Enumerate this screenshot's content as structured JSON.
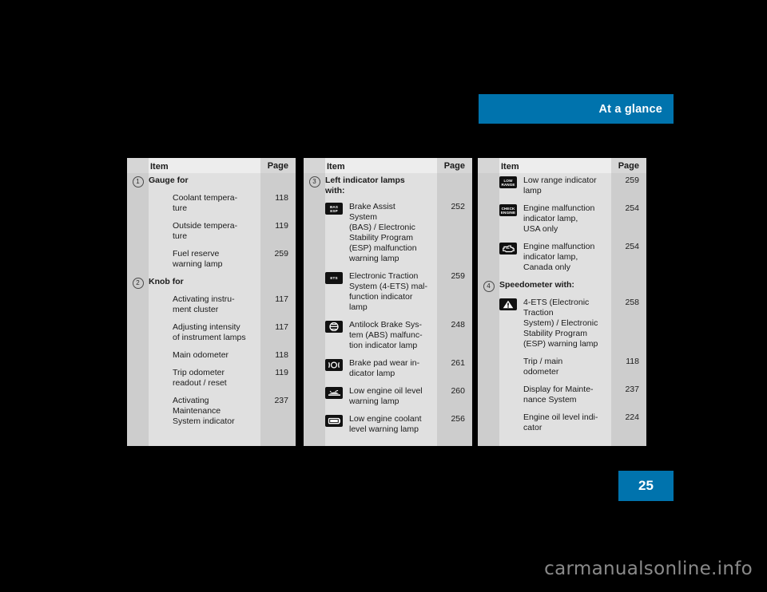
{
  "header": {
    "title": "At a glance",
    "accent_color": "#0073ad"
  },
  "page_badge": {
    "number": "25",
    "color": "#0073ad"
  },
  "watermark": "carmanualsonline.info",
  "table_headers": {
    "item": "Item",
    "page": "Page"
  },
  "tables": [
    {
      "id": "table-1",
      "rows": [
        {
          "marker": "1",
          "icon": null,
          "item": "Gauge for",
          "page": "",
          "bold": true
        },
        {
          "marker": "",
          "icon": null,
          "item": "Coolant tempera-\nture",
          "page": "118",
          "bold": false
        },
        {
          "marker": "",
          "icon": null,
          "item": "Outside tempera-\nture",
          "page": "119",
          "bold": false
        },
        {
          "marker": "",
          "icon": null,
          "item": "Fuel reserve\nwarning lamp",
          "page": "259",
          "bold": false
        },
        {
          "marker": "2",
          "icon": null,
          "item": "Knob for",
          "page": "",
          "bold": true
        },
        {
          "marker": "",
          "icon": null,
          "item": "Activating instru-\nment cluster",
          "page": "117",
          "bold": false
        },
        {
          "marker": "",
          "icon": null,
          "item": "Adjusting intensity\nof instrument lamps",
          "page": "117",
          "bold": false
        },
        {
          "marker": "",
          "icon": null,
          "item": "Main odometer",
          "page": "118",
          "bold": false
        },
        {
          "marker": "",
          "icon": null,
          "item": "Trip odometer\nreadout / reset",
          "page": "119",
          "bold": false
        },
        {
          "marker": "",
          "icon": null,
          "item": "Activating\nMaintenance\nSystem indicator",
          "page": "237",
          "bold": false
        }
      ]
    },
    {
      "id": "table-2",
      "rows": [
        {
          "marker": "3",
          "icon": null,
          "item": "Left indicator lamps\nwith:",
          "page": "",
          "bold": true
        },
        {
          "marker": "",
          "icon": "bas-esp-icon",
          "item": "Brake Assist\nSystem\n(BAS) / Electronic\nStability Program\n(ESP) malfunction\nwarning lamp",
          "page": "252",
          "bold": false
        },
        {
          "marker": "",
          "icon": "ets-icon",
          "item": "Electronic Traction\nSystem (4-ETS) mal-\nfunction indicator\nlamp",
          "page": "259",
          "bold": false
        },
        {
          "marker": "",
          "icon": "abs-icon",
          "item": "Antilock Brake Sys-\ntem (ABS) malfunc-\ntion indicator lamp",
          "page": "248",
          "bold": false
        },
        {
          "marker": "",
          "icon": "brake-pad-wear-icon",
          "item": "Brake pad wear in-\ndicator lamp",
          "page": "261",
          "bold": false
        },
        {
          "marker": "",
          "icon": "low-engine-oil-icon",
          "item": "Low engine oil level\nwarning lamp",
          "page": "260",
          "bold": false
        },
        {
          "marker": "",
          "icon": "low-coolant-icon",
          "item": "Low engine coolant\nlevel warning lamp",
          "page": "256",
          "bold": false
        }
      ]
    },
    {
      "id": "table-3",
      "rows": [
        {
          "marker": "",
          "icon": "low-range-icon",
          "item": "Low range indicator\nlamp",
          "page": "259",
          "bold": false
        },
        {
          "marker": "",
          "icon": "check-engine-icon",
          "item": "Engine malfunction\nindicator lamp,\nUSA only",
          "page": "254",
          "bold": false
        },
        {
          "marker": "",
          "icon": "engine-outline-icon",
          "item": "Engine malfunction\nindicator lamp,\nCanada only",
          "page": "254",
          "bold": false
        },
        {
          "marker": "4",
          "icon": null,
          "item": "Speedometer with:",
          "page": "",
          "bold": true
        },
        {
          "marker": "",
          "icon": "warning-triangle-icon",
          "item": "4-ETS (Electronic\nTraction\nSystem) / Electronic\nStability Program\n(ESP) warning lamp",
          "page": "258",
          "bold": false
        },
        {
          "marker": "",
          "icon": null,
          "item": "Trip / main\nodometer",
          "page": "118",
          "bold": false
        },
        {
          "marker": "",
          "icon": null,
          "item": "Display for Mainte-\nnance System",
          "page": "237",
          "bold": false
        },
        {
          "marker": "",
          "icon": null,
          "item": "Engine oil level indi-\ncator",
          "page": "224",
          "bold": false
        }
      ]
    }
  ],
  "icon_text": {
    "bas-esp-icon": "BAS\nESP",
    "ets-icon": "ETS",
    "low-range-icon": "LOW\nRANGE",
    "check-engine-icon": "CHECK\nENGINE"
  }
}
